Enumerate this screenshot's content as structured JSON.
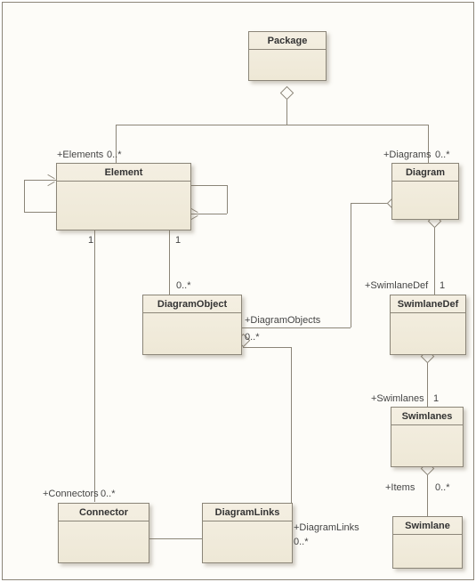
{
  "classes": {
    "package": "Package",
    "element": "Element",
    "diagram": "Diagram",
    "diagramObject": "DiagramObject",
    "swimlaneDef": "SwimlaneDef",
    "swimlanes": "Swimlanes",
    "swimlane": "Swimlane",
    "connector": "Connector",
    "diagramLinks": "DiagramLinks"
  },
  "labels": {
    "elementsRole": "+Elements",
    "elementsMult": "0..*",
    "diagramsRole": "+Diagrams",
    "diagramsMult": "0..*",
    "elem_one_a": "1",
    "elem_one_b": "1",
    "do_mult": "0..*",
    "do_role": "+DiagramObjects",
    "do_mult2": "0..*",
    "sd_role": "+SwimlaneDef",
    "sd_one": "1",
    "sl_role": "+Swimlanes",
    "sl_one": "1",
    "items_role": "+Items",
    "items_mult": "0..*",
    "conn_role": "+Connectors",
    "conn_mult": "0..*",
    "dl_role": "+DiagramLinks",
    "dl_mult": "0..*"
  }
}
